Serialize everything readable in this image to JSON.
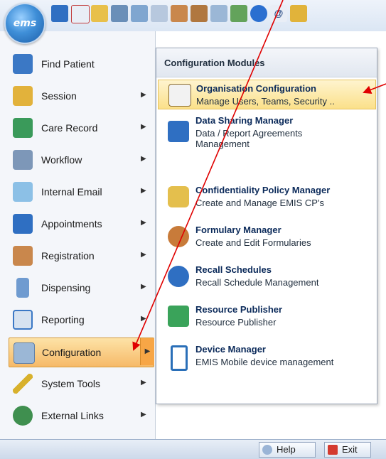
{
  "app": {
    "logo_text": "ems"
  },
  "toolbar": {
    "icons": [
      "back-arrow-icon",
      "home-icon",
      "pencil-icon",
      "people-icon",
      "calendar-icon",
      "document-icon",
      "person-icon",
      "group-icon",
      "notes-icon",
      "wrench-icon",
      "info-icon",
      "email-at-icon",
      "key-icon"
    ]
  },
  "menu": {
    "items": [
      {
        "label": "Find Patient",
        "icon": "find-patient-icon",
        "has_submenu": false
      },
      {
        "label": "Session",
        "icon": "key-icon",
        "has_submenu": true
      },
      {
        "label": "Care Record",
        "icon": "care-record-icon",
        "has_submenu": true
      },
      {
        "label": "Workflow",
        "icon": "workflow-icon",
        "has_submenu": true
      },
      {
        "label": "Internal Email",
        "icon": "envelope-icon",
        "has_submenu": true
      },
      {
        "label": "Appointments",
        "icon": "appointments-clock-icon",
        "has_submenu": true
      },
      {
        "label": "Registration",
        "icon": "registration-person-icon",
        "has_submenu": true
      },
      {
        "label": "Dispensing",
        "icon": "medicine-bottle-icon",
        "has_submenu": true
      },
      {
        "label": "Reporting",
        "icon": "report-icon",
        "has_submenu": true
      },
      {
        "label": "Configuration",
        "icon": "configuration-icon",
        "has_submenu": true,
        "active": true
      },
      {
        "label": "System Tools",
        "icon": "pencil-tool-icon",
        "has_submenu": true
      },
      {
        "label": "External Links",
        "icon": "globe-link-icon",
        "has_submenu": true
      }
    ]
  },
  "submenu": {
    "header": "Configuration Modules",
    "items": [
      {
        "title": "Organisation Configuration",
        "desc": "Manage Users, Teams, Security ..",
        "icon": "org-chart-icon",
        "highlighted": true
      },
      {
        "title": "Data Sharing Manager",
        "desc": "Data / Report Agreements Management",
        "icon": "data-sharing-icon"
      },
      {
        "title": "Confidentiality Policy Manager",
        "desc": "Create and Manage EMIS CP's",
        "icon": "padlock-icon"
      },
      {
        "title": "Formulary Manager",
        "desc": "Create and Edit Formularies",
        "icon": "magnifier-icon"
      },
      {
        "title": "Recall Schedules",
        "desc": "Recall Schedule Management",
        "icon": "recall-clock-icon"
      },
      {
        "title": "Resource Publisher",
        "desc": "Resource Publisher",
        "icon": "publish-arrow-icon"
      },
      {
        "title": "Device Manager",
        "desc": "EMIS Mobile device management",
        "icon": "mobile-device-icon"
      }
    ]
  },
  "status": {
    "help_label": "Help",
    "exit_label": "Exit"
  },
  "colors": {
    "accent": "#f6b968",
    "highlight": "#fbe08a",
    "annotation_arrow": "#e00000"
  }
}
